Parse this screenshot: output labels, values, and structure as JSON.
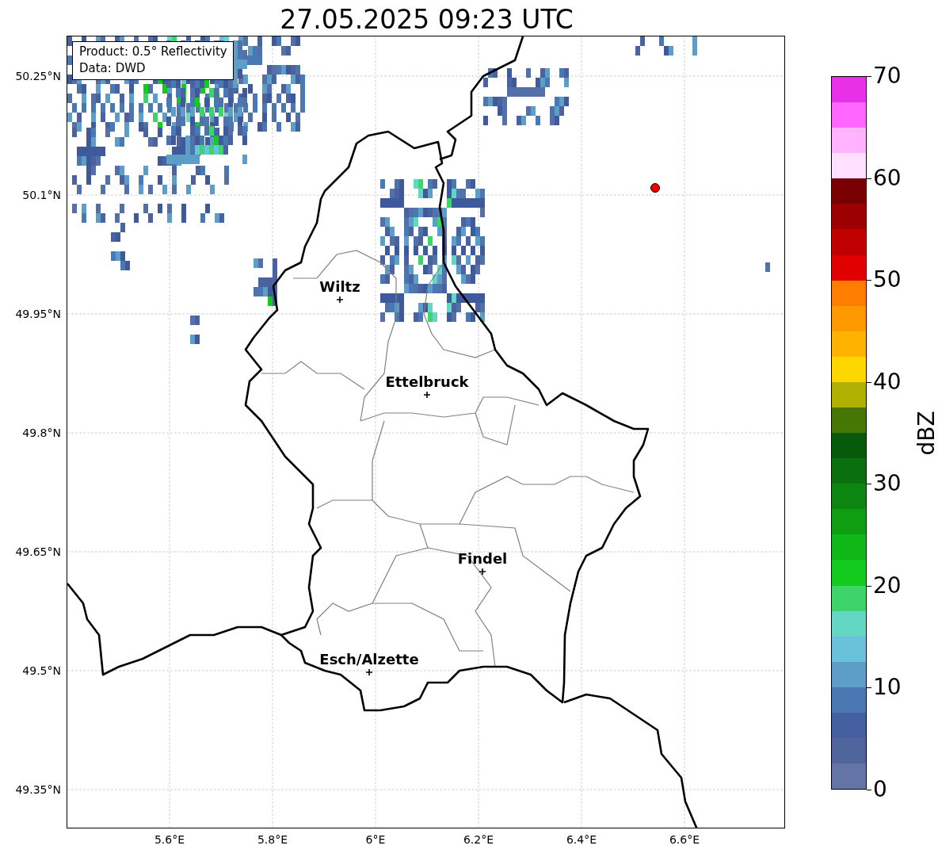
{
  "title": "27.05.2025 09:23 UTC",
  "annotation": [
    "Product: 0.5° Reflectivity",
    "Data: DWD"
  ],
  "y_ticks": [
    "50.25°N",
    "50.1°N",
    "49.95°N",
    "49.8°N",
    "49.65°N",
    "49.5°N",
    "49.35°N"
  ],
  "x_ticks": [
    "5.6°E",
    "5.8°E",
    "6°E",
    "6.2°E",
    "6.4°E",
    "6.6°E"
  ],
  "cities": [
    {
      "name": "Wiltz"
    },
    {
      "name": "Ettelbruck"
    },
    {
      "name": "Findel"
    },
    {
      "name": "Esch/Alzette"
    }
  ],
  "colorbar": {
    "label": "dBZ",
    "ticks": [
      "70",
      "60",
      "50",
      "40",
      "30",
      "20",
      "10",
      "0"
    ],
    "segments": [
      {
        "color": "#e930e9"
      },
      {
        "color": "#ff66ff"
      },
      {
        "color": "#ffb3ff"
      },
      {
        "color": "#ffe0ff"
      },
      {
        "color": "#780000"
      },
      {
        "color": "#9c0000"
      },
      {
        "color": "#c00000"
      },
      {
        "color": "#e10000"
      },
      {
        "color": "#ff7d00"
      },
      {
        "color": "#ff9900"
      },
      {
        "color": "#ffb300"
      },
      {
        "color": "#ffd700"
      },
      {
        "color": "#b0b000"
      },
      {
        "color": "#467705"
      },
      {
        "color": "#075a0a"
      },
      {
        "color": "#0a700d"
      },
      {
        "color": "#0c8610"
      },
      {
        "color": "#0f9e12"
      },
      {
        "color": "#10b817"
      },
      {
        "color": "#13cb1c"
      },
      {
        "color": "#3dd46c"
      },
      {
        "color": "#63d6c4"
      },
      {
        "color": "#6ac1db"
      },
      {
        "color": "#5d9ec8"
      },
      {
        "color": "#4a78b2"
      },
      {
        "color": "#4460a0"
      },
      {
        "color": "#50659e"
      },
      {
        "color": "#6474a6"
      }
    ]
  }
}
